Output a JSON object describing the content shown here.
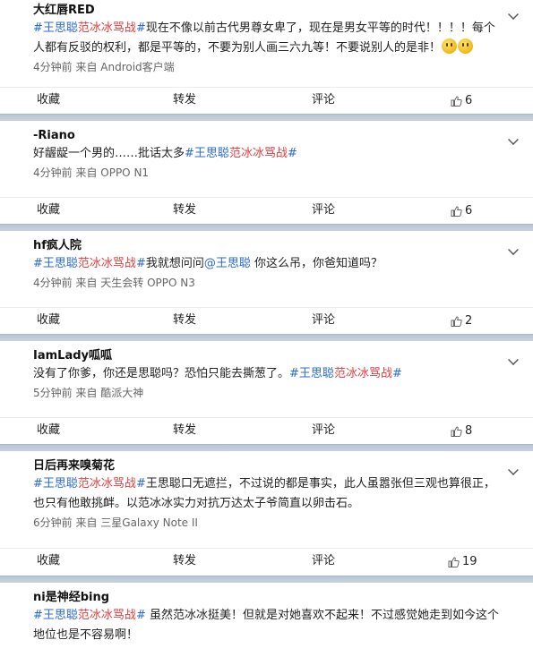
{
  "posts": [
    {
      "author": "大红唇RED",
      "segments": [
        {
          "type": "topic",
          "text": "#王思聪范冰冰骂战#"
        },
        {
          "type": "text",
          "text": "现在不像以前古代男尊女卑了，现在是男女平等的时代！！！！每个人都有反驳的权利，都是平等的，不要为别人画三六九等！不要说别人的是非！"
        }
      ],
      "emoji_count": 2,
      "meta": "4分钟前 来自 Android客户端",
      "actions": {
        "favorite": "收藏",
        "forward": "转发",
        "comment": "评论",
        "likes": "6"
      }
    },
    {
      "author": "-Riano",
      "segments": [
        {
          "type": "text",
          "text": "好龌龊一个男的……批话太多"
        },
        {
          "type": "topic",
          "text": "#王思聪范冰冰骂战#"
        }
      ],
      "meta": "4分钟前 来自 OPPO N1",
      "actions": {
        "favorite": "收藏",
        "forward": "转发",
        "comment": "评论",
        "likes": "6"
      }
    },
    {
      "author": "hf疯人院",
      "segments": [
        {
          "type": "topic",
          "text": "#王思聪范冰冰骂战#"
        },
        {
          "type": "text",
          "text": "我就想问问"
        },
        {
          "type": "mention",
          "text": "@王思聪"
        },
        {
          "type": "text",
          "text": " 你这么吊，你爸知道吗？"
        }
      ],
      "meta": "4分钟前 来自 天生会转 OPPO N3",
      "actions": {
        "favorite": "收藏",
        "forward": "转发",
        "comment": "评论",
        "likes": "2"
      }
    },
    {
      "author": "IamLady呱呱",
      "segments": [
        {
          "type": "text",
          "text": "没有了你爹，你还是思聪吗？恐怕只能去撕葱了。"
        },
        {
          "type": "topic",
          "text": "#王思聪范冰冰骂战#"
        }
      ],
      "meta": "5分钟前 来自 酷派大神",
      "actions": {
        "favorite": "收藏",
        "forward": "转发",
        "comment": "评论",
        "likes": "8"
      }
    },
    {
      "author": "日后再来嗅菊花",
      "segments": [
        {
          "type": "topic",
          "text": "#王思聪范冰冰骂战#"
        },
        {
          "type": "text",
          "text": "王思聪口无遮拦，不过说的都是事实，此人虽嚣张但三观也算很正，也只有他敢挑衅。以范冰冰实力对抗万达太子爷简直以卵击石。"
        }
      ],
      "meta": "6分钟前 来自 三星Galaxy Note II",
      "actions": {
        "favorite": "收藏",
        "forward": "转发",
        "comment": "评论",
        "likes": "19"
      }
    },
    {
      "author": "ni是神经bing",
      "segments": [
        {
          "type": "topic",
          "text": "#王思聪范冰冰骂战#"
        },
        {
          "type": "text",
          "text": " 虽然范冰冰挺美！但就是对她喜欢不起来！不过感觉她走到如今这个地位也是不容易啊！"
        }
      ],
      "meta": "",
      "actions": null
    }
  ],
  "colors": {
    "topic_blue": "#2a6ad6",
    "topic_red": "#e04040",
    "divider": "#c0ccd9"
  },
  "icons": {
    "like": "thumbs-up-icon",
    "menu": "chevron-down-icon"
  }
}
